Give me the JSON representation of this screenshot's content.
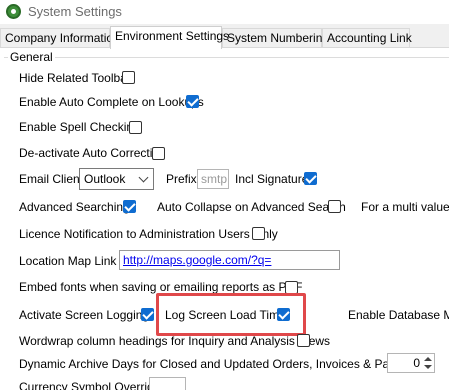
{
  "window": {
    "title": "System Settings"
  },
  "tabs": [
    {
      "label": "Company Information"
    },
    {
      "label": "Environment Settings"
    },
    {
      "label": "System Numbering"
    },
    {
      "label": "Accounting Link"
    }
  ],
  "group": {
    "label": "General"
  },
  "settings": {
    "hide_related_toolbar": {
      "label": "Hide Related Toolbar",
      "checked": false
    },
    "enable_auto_complete": {
      "label": "Enable Auto Complete on Lookups",
      "checked": true
    },
    "enable_spell_checking": {
      "label": "Enable Spell Checking",
      "checked": false
    },
    "deactivate_auto_correcting": {
      "label": "De-activate Auto Correcting",
      "checked": false
    },
    "email_client": {
      "label": "Email Client",
      "value": "Outlook"
    },
    "prefix": {
      "label": "Prefix",
      "placeholder": "smtp:"
    },
    "incl_signature": {
      "label": "Incl Signature",
      "checked": true
    },
    "advanced_searching": {
      "label": "Advanced Searching",
      "checked": true
    },
    "auto_collapse": {
      "label": "Auto Collapse on Advanced Search",
      "checked": false
    },
    "multi_value": {
      "label": "For a multi value se"
    },
    "licence_notification": {
      "label": "Licence Notification to Administration Users Only",
      "checked": false
    },
    "location_map_link": {
      "label": "Location Map Link",
      "value": "http://maps.google.com/?q="
    },
    "embed_fonts": {
      "label": "Embed fonts when saving or emailing reports as PDF",
      "checked": false
    },
    "activate_screen_logging": {
      "label": "Activate Screen Logging",
      "checked": true
    },
    "log_screen_load_time": {
      "label": "Log Screen Load Time",
      "checked": true
    },
    "enable_database": {
      "label": "Enable Database Me"
    },
    "wordwrap_headings": {
      "label": "Wordwrap column headings for Inquiry and Analysis Views",
      "checked": false
    },
    "dynamic_archive_days": {
      "label": "Dynamic Archive Days for Closed and Updated Orders, Invoices & Payments",
      "value": "0"
    },
    "currency_symbol_override": {
      "label": "Currency Symbol Override",
      "value": ""
    }
  },
  "colors": {
    "accent": "#0f6cd0",
    "highlight": "#e0484a"
  }
}
